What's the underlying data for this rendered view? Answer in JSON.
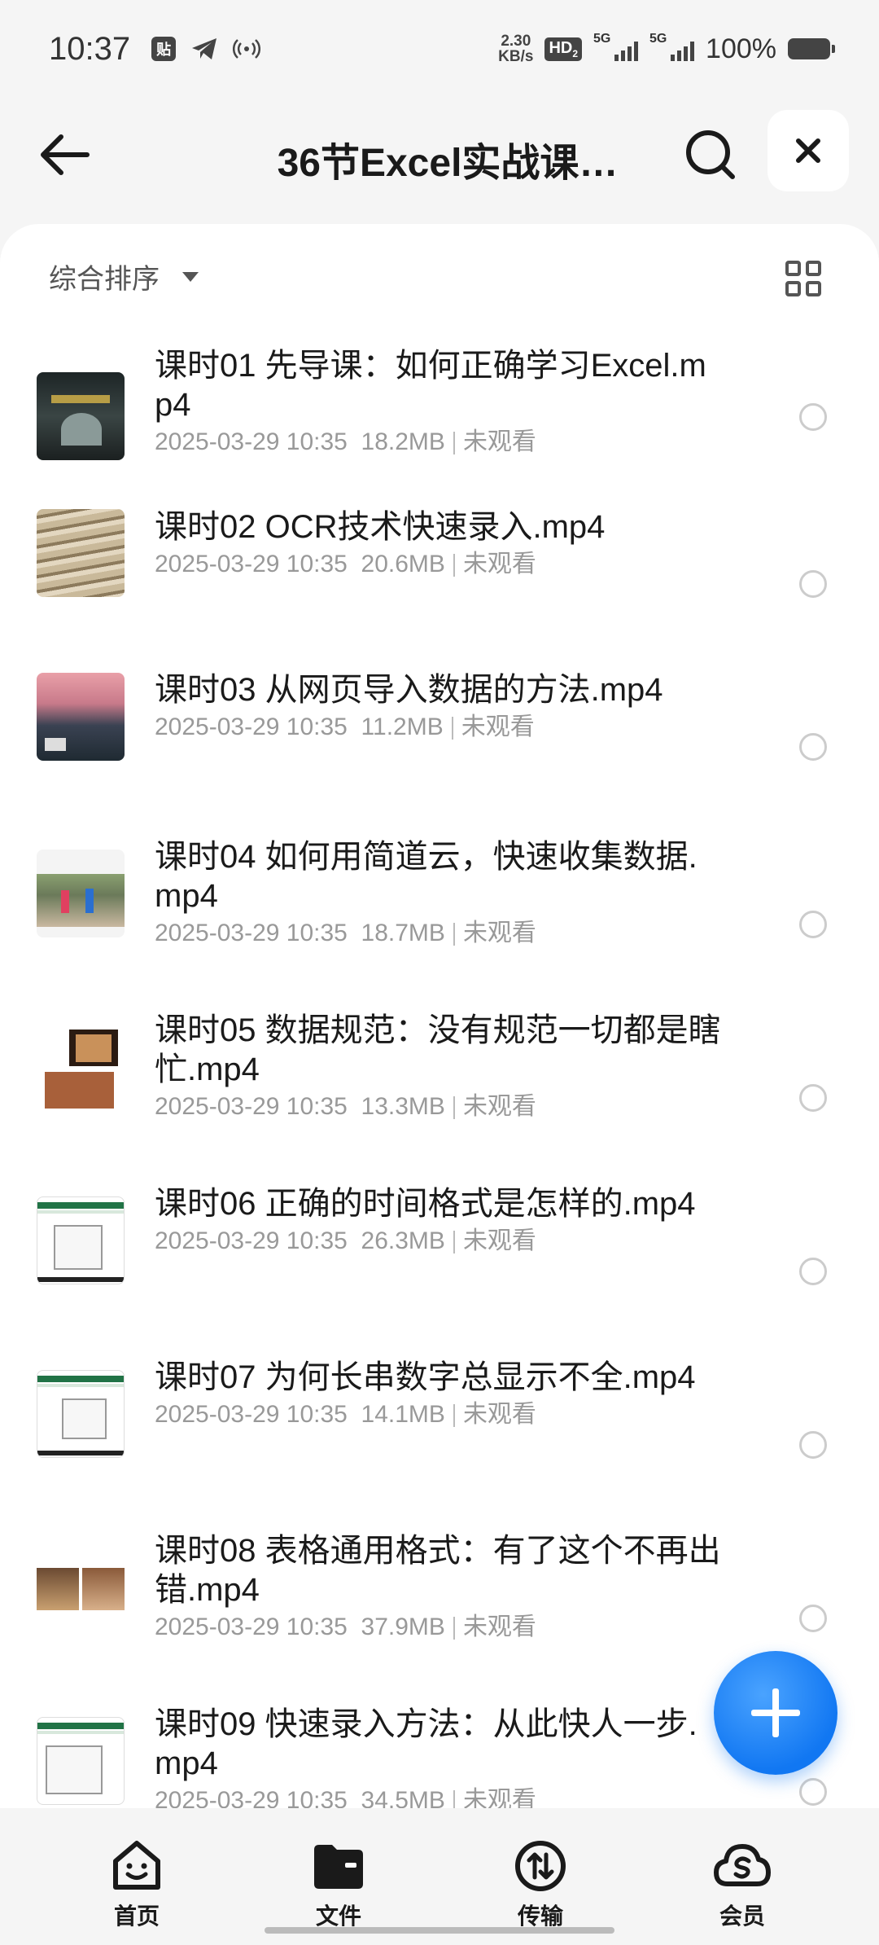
{
  "status_bar": {
    "time": "10:37",
    "net_speed_value": "2.30",
    "net_speed_unit": "KB/s",
    "hd_label": "HD",
    "hd_sub": "2",
    "sim1_label": "5G",
    "sim2_label": "5G",
    "battery_text": "100%"
  },
  "header": {
    "title": "36节Excel实战课…"
  },
  "toolbar": {
    "sort_label": "综合排序"
  },
  "files": [
    {
      "name": "课时01 先导课：如何正确学习Excel.mp4",
      "date": "2025-03-29 10:35",
      "size": "18.2MB",
      "status": "未观看"
    },
    {
      "name": "课时02 OCR技术快速录入.mp4",
      "date": "2025-03-29 10:35",
      "size": "20.6MB",
      "status": "未观看"
    },
    {
      "name": "课时03 从网页导入数据的方法.mp4",
      "date": "2025-03-29 10:35",
      "size": "11.2MB",
      "status": "未观看"
    },
    {
      "name": "课时04 如何用简道云，快速收集数据.mp4",
      "date": "2025-03-29 10:35",
      "size": "18.7MB",
      "status": "未观看"
    },
    {
      "name": "课时05 数据规范：没有规范一切都是瞎忙.mp4",
      "date": "2025-03-29 10:35",
      "size": "13.3MB",
      "status": "未观看"
    },
    {
      "name": "课时06 正确的时间格式是怎样的.mp4",
      "date": "2025-03-29 10:35",
      "size": "26.3MB",
      "status": "未观看"
    },
    {
      "name": "课时07 为何长串数字总显示不全.mp4",
      "date": "2025-03-29 10:35",
      "size": "14.1MB",
      "status": "未观看"
    },
    {
      "name": "课时08 表格通用格式：有了这个不再出错.mp4",
      "date": "2025-03-29 10:35",
      "size": "37.9MB",
      "status": "未观看"
    },
    {
      "name": "课时09 快速录入方法：从此快人一步.mp4",
      "date": "2025-03-29 10:35",
      "size": "34.5MB",
      "status": "未观看"
    }
  ],
  "bottom_nav": [
    {
      "label": "首页"
    },
    {
      "label": "文件"
    },
    {
      "label": "传输"
    },
    {
      "label": "会员"
    }
  ],
  "colors": {
    "accent": "#1177f2",
    "text_primary": "#1a1a1a",
    "text_secondary": "#999999"
  }
}
